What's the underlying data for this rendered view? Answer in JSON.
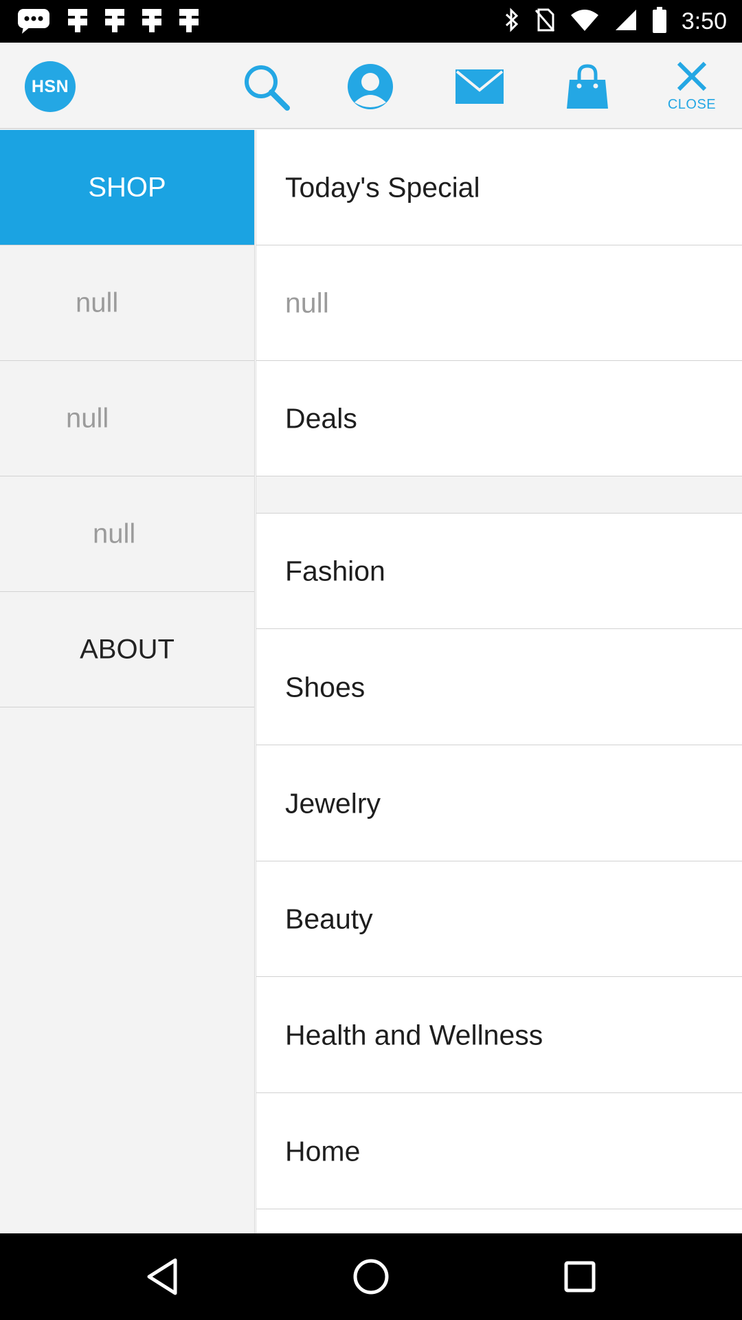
{
  "status_bar": {
    "time": "3:50",
    "icons": [
      "message-icon",
      "notification-icon",
      "notification-icon",
      "notification-icon",
      "notification-icon",
      "bluetooth-icon",
      "no-sim-icon",
      "wifi-icon",
      "signal-icon",
      "battery-icon"
    ]
  },
  "app_bar": {
    "logo_text": "HSN",
    "close_label": "CLOSE",
    "icons": [
      "search-icon",
      "profile-icon",
      "mail-icon",
      "shopping-bag-icon",
      "close-icon"
    ]
  },
  "left_menu": {
    "items": [
      {
        "label": "SHOP",
        "active": true
      },
      {
        "label": "null"
      },
      {
        "label": "null"
      },
      {
        "label": "null"
      },
      {
        "label": "ABOUT"
      }
    ]
  },
  "right_menu": {
    "items": [
      {
        "label": "Today's Special"
      },
      {
        "label": "null"
      },
      {
        "label": "Deals"
      },
      {
        "label": "Fashion"
      },
      {
        "label": "Shoes"
      },
      {
        "label": "Jewelry"
      },
      {
        "label": "Beauty"
      },
      {
        "label": "Health and Wellness"
      },
      {
        "label": "Home"
      }
    ]
  },
  "colors": {
    "accent": "#1ba3e2",
    "bar_background": "#f4f4f4",
    "panel_background": "#f3f3f3"
  },
  "nav_bar": {
    "icons": [
      "back-icon",
      "home-icon",
      "recents-icon"
    ]
  }
}
